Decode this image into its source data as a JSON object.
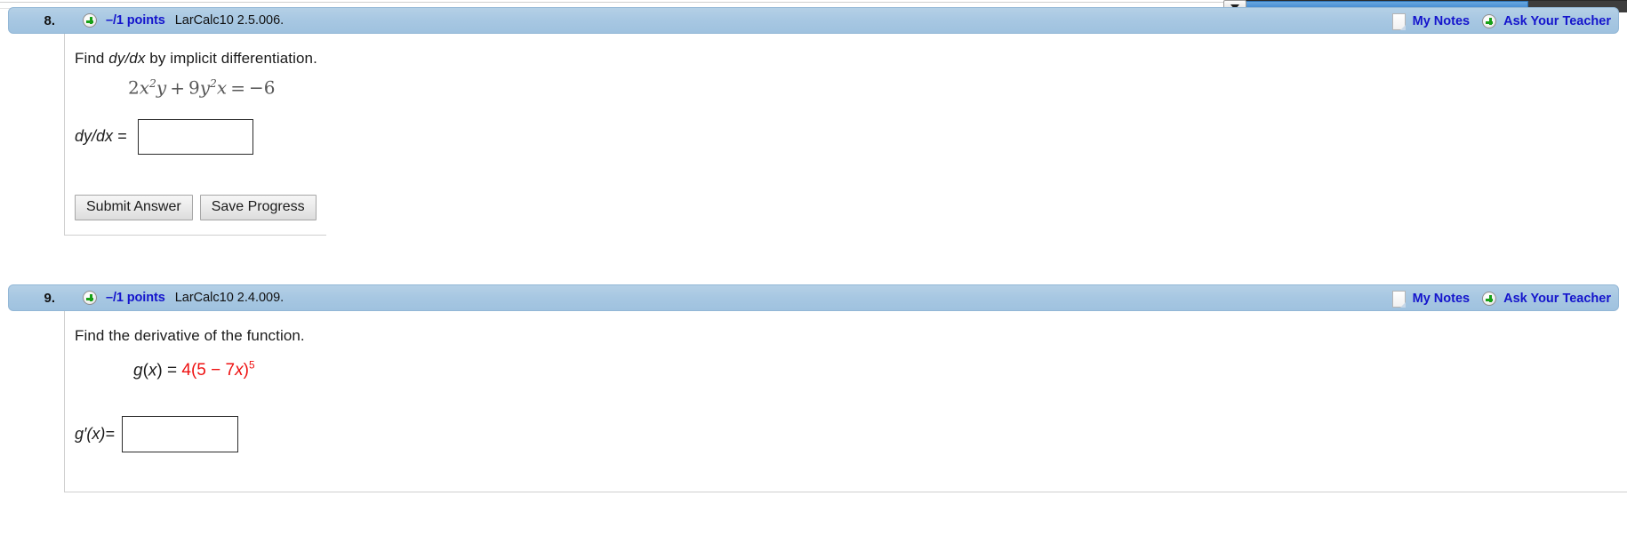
{
  "scrollbar": {
    "arrow_icon": "chevron-down-icon",
    "orientation": "horizontal"
  },
  "questions": [
    {
      "number": "8.",
      "points": "–/1 points",
      "code": "LarCalc10 2.5.006.",
      "expand_icon": "plus-circle-icon",
      "notes_icon": "note-page-icon",
      "notes_label": "My Notes",
      "teacher_icon": "plus-circle-icon",
      "teacher_label": "Ask Your Teacher",
      "prompt_pre": "Find ",
      "prompt_em": "dy/dx",
      "prompt_post": " by implicit differentiation.",
      "equation_plain": "2x^2 y + 9y^2 x = -6",
      "equation_parts": {
        "c1": "2",
        "v1": "x",
        "e1": "2",
        "v2": "y",
        "op1": "+",
        "c2": "9",
        "v3": "y",
        "e2": "2",
        "v4": "x",
        "op2": "=",
        "rhs": "−6"
      },
      "answer_label": "dy/dx",
      "answer_equals": " = ",
      "answer_value": "",
      "answer_placeholder": "",
      "buttons": [
        "Submit Answer",
        "Save Progress"
      ]
    },
    {
      "number": "9.",
      "points": "–/1 points",
      "code": "LarCalc10 2.4.009.",
      "expand_icon": "plus-circle-icon",
      "notes_icon": "note-page-icon",
      "notes_label": "My Notes",
      "teacher_icon": "plus-circle-icon",
      "teacher_label": "Ask Your Teacher",
      "prompt_pre": "Find the derivative of the function.",
      "prompt_em": "",
      "prompt_post": "",
      "equation_plain": "g(x) = 4(5 - 7x)^5",
      "equation_parts": {
        "fn": "g",
        "arg_open": "(",
        "arg": "x",
        "arg_close": ")",
        "equals": " = ",
        "coef": "4",
        "paren_open": "(",
        "inner_a": "5",
        "minus": " − ",
        "inner_b": "7",
        "inner_var": "x",
        "paren_close": ")",
        "exponent": "5"
      },
      "answer_label": "g′(x)",
      "answer_equals": "=",
      "answer_value": "",
      "answer_placeholder": "",
      "buttons": []
    }
  ],
  "colors": {
    "header_blue": "#a7c7e2",
    "link_blue": "#1414cc",
    "highlight_red": "#ee1111",
    "plus_green": "#17a017",
    "scroll_thumb": "#4a8fd4",
    "latex_gray": "#585858"
  }
}
